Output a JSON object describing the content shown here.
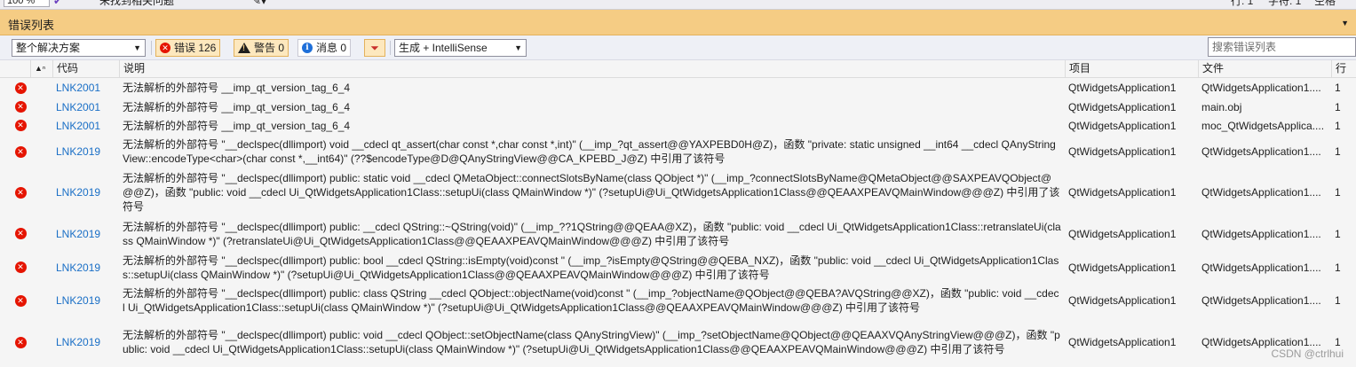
{
  "topbar": {
    "zoom": "100 %",
    "no_issues": "未找到相关问题",
    "line": "行: 1",
    "char": "字符: 1",
    "spaces": "空格"
  },
  "panel": {
    "title": "错误列表"
  },
  "toolbar": {
    "scope": "整个解决方案",
    "errors_label": "错误 126",
    "warnings_label": "警告 0",
    "messages_label": "消息 0",
    "build_filter": "生成 + IntelliSense",
    "search_placeholder": "搜索错误列表"
  },
  "columns": {
    "code": "代码",
    "description": "说明",
    "project": "项目",
    "file": "文件",
    "line": "行"
  },
  "rows": [
    {
      "code": "LNK2001",
      "description": "无法解析的外部符号 __imp_qt_version_tag_6_4",
      "project": "QtWidgetsApplication1",
      "file": "QtWidgetsApplication1....",
      "line": "1"
    },
    {
      "code": "LNK2001",
      "description": "无法解析的外部符号 __imp_qt_version_tag_6_4",
      "project": "QtWidgetsApplication1",
      "file": "main.obj",
      "line": "1"
    },
    {
      "code": "LNK2001",
      "description": "无法解析的外部符号 __imp_qt_version_tag_6_4",
      "project": "QtWidgetsApplication1",
      "file": "moc_QtWidgetsApplica....",
      "line": "1"
    },
    {
      "code": "LNK2019",
      "description": "无法解析的外部符号 \"__declspec(dllimport) void __cdecl qt_assert(char const *,char const *,int)\" (__imp_?qt_assert@@YAXPEBD0H@Z)，函数 \"private: static unsigned __int64 __cdecl QAnyStringView::encodeType<char>(char const *,__int64)\" (??$encodeType@D@QAnyStringView@@CA_KPEBD_J@Z) 中引用了该符号",
      "project": "QtWidgetsApplication1",
      "file": "QtWidgetsApplication1....",
      "line": "1"
    },
    {
      "code": "LNK2019",
      "description": "无法解析的外部符号 \"__declspec(dllimport) public: static void __cdecl QMetaObject::connectSlotsByName(class QObject *)\" (__imp_?connectSlotsByName@QMetaObject@@SAXPEAVQObject@@@Z)，函数 \"public: void __cdecl Ui_QtWidgetsApplication1Class::setupUi(class QMainWindow *)\" (?setupUi@Ui_QtWidgetsApplication1Class@@QEAAXPEAVQMainWindow@@@Z) 中引用了该符号",
      "project": "QtWidgetsApplication1",
      "file": "QtWidgetsApplication1....",
      "line": "1"
    },
    {
      "code": "LNK2019",
      "description": "无法解析的外部符号 \"__declspec(dllimport) public: __cdecl QString::~QString(void)\" (__imp_??1QString@@QEAA@XZ)，函数 \"public: void __cdecl Ui_QtWidgetsApplication1Class::retranslateUi(class QMainWindow *)\" (?retranslateUi@Ui_QtWidgetsApplication1Class@@QEAAXPEAVQMainWindow@@@Z) 中引用了该符号",
      "project": "QtWidgetsApplication1",
      "file": "QtWidgetsApplication1....",
      "line": "1"
    },
    {
      "code": "LNK2019",
      "description": "无法解析的外部符号 \"__declspec(dllimport) public: bool __cdecl QString::isEmpty(void)const \" (__imp_?isEmpty@QString@@QEBA_NXZ)，函数 \"public: void __cdecl Ui_QtWidgetsApplication1Class::setupUi(class QMainWindow *)\" (?setupUi@Ui_QtWidgetsApplication1Class@@QEAAXPEAVQMainWindow@@@Z) 中引用了该符号",
      "project": "QtWidgetsApplication1",
      "file": "QtWidgetsApplication1....",
      "line": "1"
    },
    {
      "code": "LNK2019",
      "description": "无法解析的外部符号 \"__declspec(dllimport) public: class QString __cdecl QObject::objectName(void)const \" (__imp_?objectName@QObject@@QEBA?AVQString@@XZ)，函数 \"public: void __cdecl Ui_QtWidgetsApplication1Class::setupUi(class QMainWindow *)\" (?setupUi@Ui_QtWidgetsApplication1Class@@QEAAXPEAVQMainWindow@@@Z) 中引用了该符号",
      "project": "QtWidgetsApplication1",
      "file": "QtWidgetsApplication1....",
      "line": "1"
    },
    {
      "code": "LNK2019",
      "description": "无法解析的外部符号 \"__declspec(dllimport) public: void __cdecl QObject::setObjectName(class QAnyStringView)\" (__imp_?setObjectName@QObject@@QEAAXVQAnyStringView@@@Z)，函数 \"public: void __cdecl Ui_QtWidgetsApplication1Class::setupUi(class QMainWindow *)\" (?setupUi@Ui_QtWidgetsApplication1Class@@QEAAXPEAVQMainWindow@@@Z) 中引用了该符号",
      "project": "QtWidgetsApplication1",
      "file": "QtWidgetsApplication1....",
      "line": "1"
    }
  ],
  "watermark": "CSDN @ctrlhui",
  "colors": {
    "title_bg": "#f5cc84",
    "error_red": "#e51400",
    "link_blue": "#1a6fc6"
  }
}
